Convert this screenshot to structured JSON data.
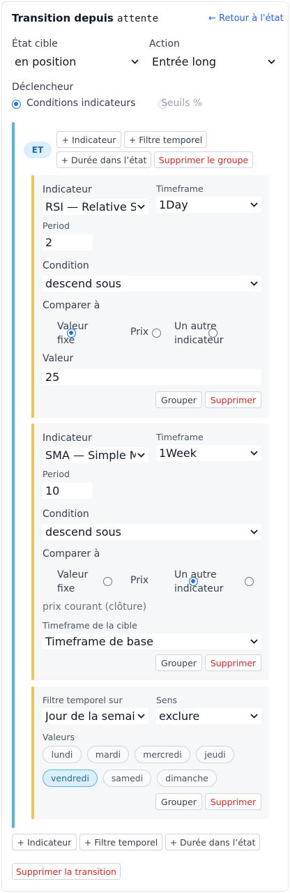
{
  "header": {
    "title_prefix": "Transition depuis",
    "state_code": "attente",
    "back_link": "← Retour à l'état"
  },
  "target": {
    "label": "État cible",
    "value": "en position"
  },
  "action": {
    "label": "Action",
    "value": "Entrée long"
  },
  "trigger": {
    "label": "Déclencheur",
    "options": [
      "Conditions indicateurs",
      "Seuils %"
    ],
    "selected": "Conditions indicateurs"
  },
  "group": {
    "operator": "ET",
    "buttons": {
      "add_indicator": "+ Indicateur",
      "add_time_filter": "+ Filtre temporel",
      "add_duration": "+ Durée dans l’état",
      "delete_group": "Supprimer le groupe"
    }
  },
  "conditions": [
    {
      "indicator_label": "Indicateur",
      "indicator": "RSI — Relative Strength Index",
      "timeframe_label": "Timeframe",
      "timeframe": "1Day",
      "param_label": "Period",
      "param_value": "2",
      "condition_label": "Condition",
      "condition": "descend sous",
      "compare_label": "Comparer à",
      "compare_options": [
        "Valeur fixe",
        "Prix",
        "Un autre indicateur"
      ],
      "compare_selected": "Valeur fixe",
      "value_label": "Valeur",
      "value": "25",
      "group_button": "Grouper",
      "delete_button": "Supprimer"
    },
    {
      "indicator_label": "Indicateur",
      "indicator": "SMA — Simple Moving Average",
      "timeframe_label": "Timeframe",
      "timeframe": "1Week",
      "param_label": "Period",
      "param_value": "10",
      "condition_label": "Condition",
      "condition": "descend sous",
      "compare_label": "Comparer à",
      "compare_options": [
        "Valeur fixe",
        "Prix",
        "Un autre indicateur"
      ],
      "compare_selected": "Prix",
      "price_note": "prix courant (clôture)",
      "target_tf_label": "Timeframe de la cible",
      "target_tf": "Timeframe de base",
      "group_button": "Grouper",
      "delete_button": "Supprimer"
    }
  ],
  "time_filter": {
    "filter_label": "Filtre temporel sur",
    "filter": "Jour de la semaine",
    "sense_label": "Sens",
    "sense": "exclure",
    "values_label": "Valeurs",
    "days": [
      "lundi",
      "mardi",
      "mercredi",
      "jeudi",
      "vendredi",
      "samedi",
      "dimanche"
    ],
    "selected_days": [
      "vendredi"
    ],
    "group_button": "Grouper",
    "delete_button": "Supprimer"
  },
  "footer": {
    "add_indicator": "+ Indicateur",
    "add_time_filter": "+ Filtre temporel",
    "add_duration": "+ Durée dans l’état",
    "delete_transition": "Supprimer la transition"
  },
  "colors": {
    "group_accent": "#4fb6e6",
    "card_accent": "#f2c14e",
    "link": "#2563eb",
    "danger": "#dc2626",
    "radio": "#1a73e8"
  }
}
